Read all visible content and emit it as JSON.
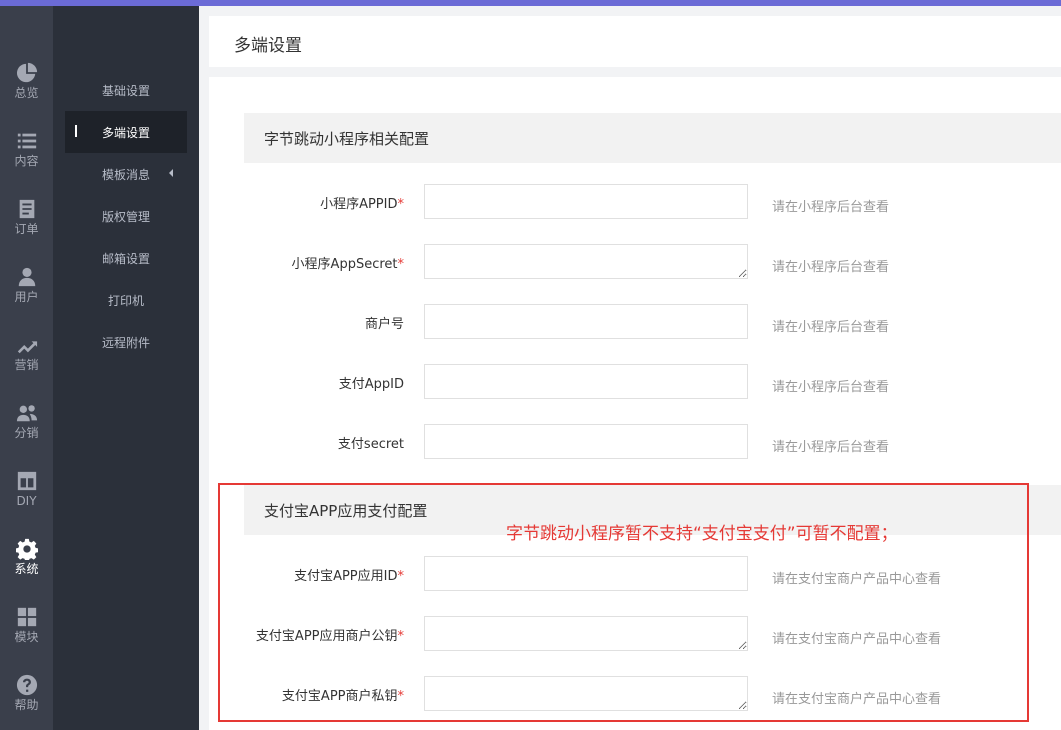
{
  "icon_sidebar": [
    {
      "label": "总览",
      "icon": "pie-chart-icon"
    },
    {
      "label": "内容",
      "icon": "list-icon"
    },
    {
      "label": "订单",
      "icon": "document-icon"
    },
    {
      "label": "用户",
      "icon": "user-icon"
    },
    {
      "label": "营销",
      "icon": "trend-icon"
    },
    {
      "label": "分销",
      "icon": "users-icon"
    },
    {
      "label": "DIY",
      "icon": "layout-icon"
    },
    {
      "label": "系统",
      "icon": "gear-icon",
      "active": true
    },
    {
      "label": "模块",
      "icon": "grid-icon"
    },
    {
      "label": "帮助",
      "icon": "help-icon"
    }
  ],
  "sub_sidebar": [
    {
      "label": "基础设置"
    },
    {
      "label": "多端设置",
      "active": true
    },
    {
      "label": "模板消息"
    },
    {
      "label": "版权管理"
    },
    {
      "label": "邮箱设置"
    },
    {
      "label": "打印机"
    },
    {
      "label": "远程附件"
    }
  ],
  "page": {
    "title": "多端设置"
  },
  "section1": {
    "title": "字节跳动小程序相关配置",
    "fields": [
      {
        "label": "小程序APPID",
        "required": true,
        "hint": "请在小程序后台查看"
      },
      {
        "label": "小程序AppSecret",
        "required": true,
        "hint": "请在小程序后台查看"
      },
      {
        "label": "商户号",
        "required": false,
        "hint": "请在小程序后台查看"
      },
      {
        "label": "支付AppID",
        "required": false,
        "hint": "请在小程序后台查看"
      },
      {
        "label": "支付secret",
        "required": false,
        "hint": "请在小程序后台查看"
      }
    ]
  },
  "section2": {
    "title": "支付宝APP应用支付配置",
    "note": "字节跳动小程序暂不支持“支付宝支付”可暂不配置；",
    "fields": [
      {
        "label": "支付宝APP应用ID",
        "required": true,
        "hint": "请在支付宝商户产品中心查看"
      },
      {
        "label": "支付宝APP应用商户公钥",
        "required": true,
        "hint": "请在支付宝商户产品中心查看"
      },
      {
        "label": "支付宝APP商户私钥",
        "required": true,
        "hint": "请在支付宝商户产品中心查看"
      }
    ]
  },
  "required_mark": "*",
  "colors": {
    "accent_top": "#6b6bd6",
    "required": "#e53935",
    "annotation": "#e53935",
    "sidebar_dark": "#2b303a",
    "sidebar_icons": "#3a3f4b"
  }
}
